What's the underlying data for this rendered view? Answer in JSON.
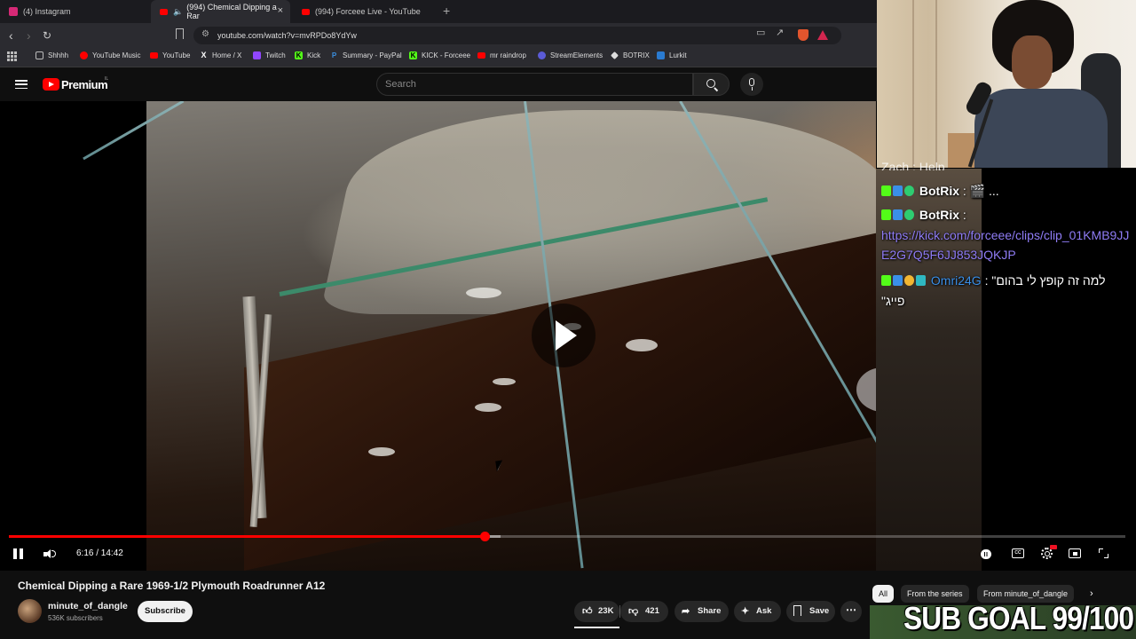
{
  "browser": {
    "tabs": [
      {
        "title": "(4) Instagram",
        "color": "#d62976",
        "active": false
      },
      {
        "title": "(994) Chemical Dipping a Rar",
        "color": "#ff0000",
        "active": true,
        "audio": true
      },
      {
        "title": "(994) Forceee Live - YouTube",
        "color": "#ff0000",
        "active": false
      }
    ],
    "url": "youtube.com/watch?v=mvRPDo8YdYw",
    "bookmarks": [
      {
        "label": "Shhhh",
        "icon": "folder-icon",
        "color": "#888888"
      },
      {
        "label": "YouTube Music",
        "icon": "youtube-music-icon",
        "color": "#ff0000"
      },
      {
        "label": "YouTube",
        "icon": "youtube-icon",
        "color": "#ff0000"
      },
      {
        "label": "Home / X",
        "icon": "x-icon",
        "color": "#000000"
      },
      {
        "label": "Twitch",
        "icon": "twitch-icon",
        "color": "#9146ff"
      },
      {
        "label": "Kick",
        "icon": "kick-icon",
        "color": "#53fc18"
      },
      {
        "label": "Summary - PayPal",
        "icon": "paypal-icon",
        "color": "#0070e0"
      },
      {
        "label": "KICK - Forceee",
        "icon": "kick-icon",
        "color": "#53fc18"
      },
      {
        "label": "mr raindrop",
        "icon": "youtube-icon",
        "color": "#ff0000"
      },
      {
        "label": "StreamElements",
        "icon": "streamelements-icon",
        "color": "#5b5bd6"
      },
      {
        "label": "BOTRIX",
        "icon": "botrix-icon",
        "color": "#dddddd"
      },
      {
        "label": "Lurkit",
        "icon": "lurkit-icon",
        "color": "#2a7bd1"
      }
    ]
  },
  "youtube": {
    "brand": "Premium",
    "brand_region": "IL",
    "search_placeholder": "Search"
  },
  "player": {
    "time_display": "6:16 / 14:42",
    "progress_fraction": 0.4263,
    "buffer_fraction": 0.44,
    "hd_badge": "HD",
    "cc_label": "CC"
  },
  "video": {
    "title": "Chemical Dipping a Rare 1969-1/2 Plymouth Roadrunner A12",
    "channel": "minute_of_dangle",
    "subscribers": "536K subscribers",
    "subscribe_label": "Subscribe",
    "likes": "23K",
    "dislikes": "421",
    "share_label": "Share",
    "ask_label": "Ask",
    "save_label": "Save"
  },
  "chips": [
    "All",
    "From the series",
    "From minute_of_dangle"
  ],
  "stream_overlay": {
    "chat_partial": "Zach : Help",
    "chat": [
      {
        "user": "BotRix",
        "sep": " :",
        "text": " 🎬 ..."
      },
      {
        "user": "BotRix",
        "sep": " :",
        "text": ""
      },
      {
        "link": "https://kick.com/forceee/clips/clip_01KMB9JJE2G7Q5F6JJ853JQKJP"
      },
      {
        "user": "Omri24G",
        "sep": " :",
        "text": " \"למה זה קופץ לי בהום",
        "text2": "\"פייג"
      }
    ],
    "sub_goal": "SUB GOAL 99/100"
  }
}
